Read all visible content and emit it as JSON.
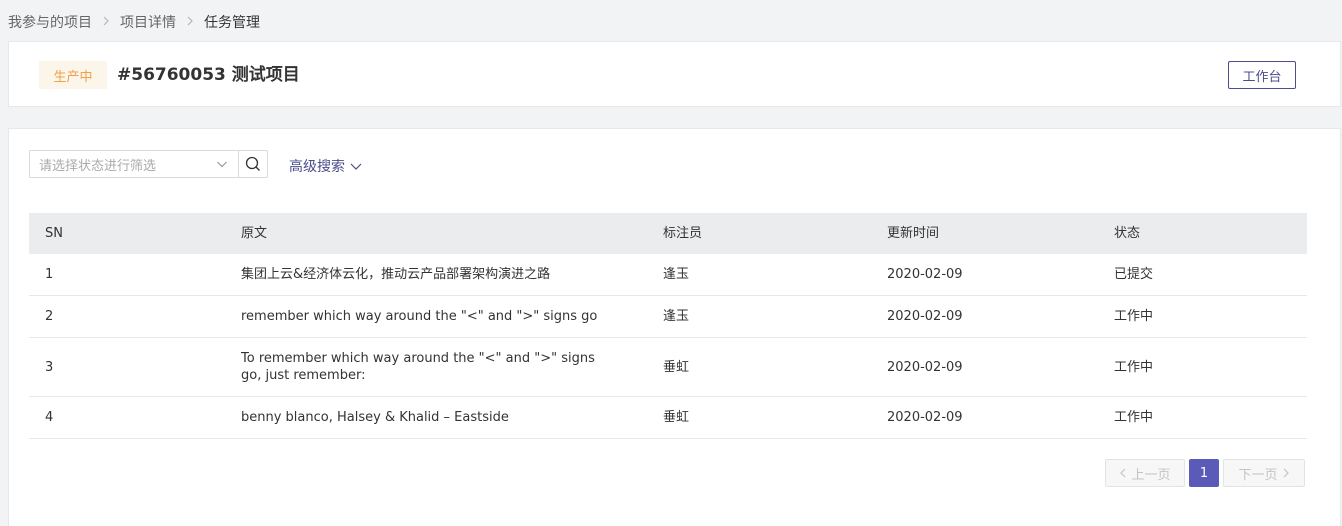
{
  "breadcrumb": {
    "items": [
      "我参与的项目",
      "项目详情",
      "任务管理"
    ],
    "separator": ">"
  },
  "header": {
    "status_tag": "生产中",
    "title": "#56760053 测试项目",
    "workbench_label": "工作台"
  },
  "filter": {
    "placeholder": "请选择状态进行筛选",
    "advanced_search": "高级搜索"
  },
  "table": {
    "headers": [
      "SN",
      "原文",
      "标注员",
      "更新时间",
      "状态"
    ],
    "rows": [
      {
        "sn": "1",
        "text": "集团上云&经济体云化，推动云产品部署架构演进之路",
        "annotator": "逢玉",
        "time": "2020-02-09",
        "status": "已提交"
      },
      {
        "sn": "2",
        "text": "remember which way around the \"<\" and \">\" signs go",
        "annotator": "逢玉",
        "time": "2020-02-09",
        "status": "工作中"
      },
      {
        "sn": "3",
        "text": "To remember which way around the \"<\" and \">\" signs go, just remember:",
        "annotator": "垂虹",
        "time": "2020-02-09",
        "status": "工作中"
      },
      {
        "sn": "4",
        "text": "benny blanco, Halsey & Khalid – Eastside",
        "annotator": "垂虹",
        "time": "2020-02-09",
        "status": "工作中"
      }
    ]
  },
  "pagination": {
    "prev": "上一页",
    "current": "1",
    "next": "下一页"
  },
  "colors": {
    "accent": "#4c4d8c",
    "page_active": "#5a5bb8",
    "status_tag_bg": "#fcf5ea",
    "status_tag_text": "#f0a14a"
  }
}
